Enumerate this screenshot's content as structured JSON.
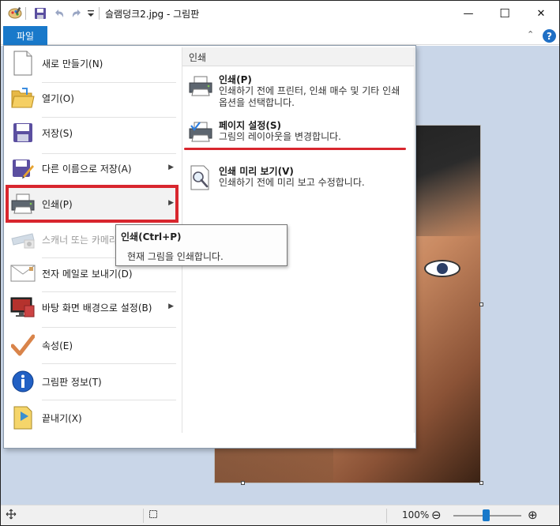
{
  "window": {
    "title": "슬램덩크2.jpg - 그림판",
    "minimize_glyph": "—",
    "maximize_glyph": "☐",
    "close_glyph": "✕"
  },
  "ribbon": {
    "file_tab": "파일",
    "collapse_glyph": "⌃",
    "help_glyph": "?"
  },
  "file_menu": {
    "items": [
      {
        "label": "새로 만들기(N)"
      },
      {
        "label": "열기(O)"
      },
      {
        "label": "저장(S)"
      },
      {
        "label": "다른 이름으로 저장(A)"
      },
      {
        "label": "인쇄(P)"
      },
      {
        "label": "스캐너 또는 카메라"
      },
      {
        "label": "전자 메일로 보내기(D)"
      },
      {
        "label": "바탕 화면 배경으로 설정(B)"
      },
      {
        "label": "속성(E)"
      },
      {
        "label": "그림판 정보(T)"
      },
      {
        "label": "끝내기(X)"
      }
    ],
    "submenu_arrow": "▶"
  },
  "print_submenu": {
    "header": "인쇄",
    "items": [
      {
        "title": "인쇄(P)",
        "desc": "인쇄하기 전에 프린터, 인쇄 매수 및 기타 인쇄 옵션을 선택합니다."
      },
      {
        "title": "페이지 설정(S)",
        "desc": "그림의 레이아웃을 변경합니다."
      },
      {
        "title": "인쇄 미리 보기(V)",
        "desc": "인쇄하기 전에 미리 보고 수정합니다."
      }
    ]
  },
  "tooltip": {
    "title": "인쇄(Ctrl+P)",
    "desc": "현재 그림을 인쇄합니다."
  },
  "statusbar": {
    "zoom_level": "100%",
    "zoom_out_glyph": "⊖",
    "zoom_in_glyph": "⊕",
    "zoom_fraction": 0.5
  },
  "colors": {
    "accent": "#1979ca",
    "highlight_red": "#d8262e"
  }
}
